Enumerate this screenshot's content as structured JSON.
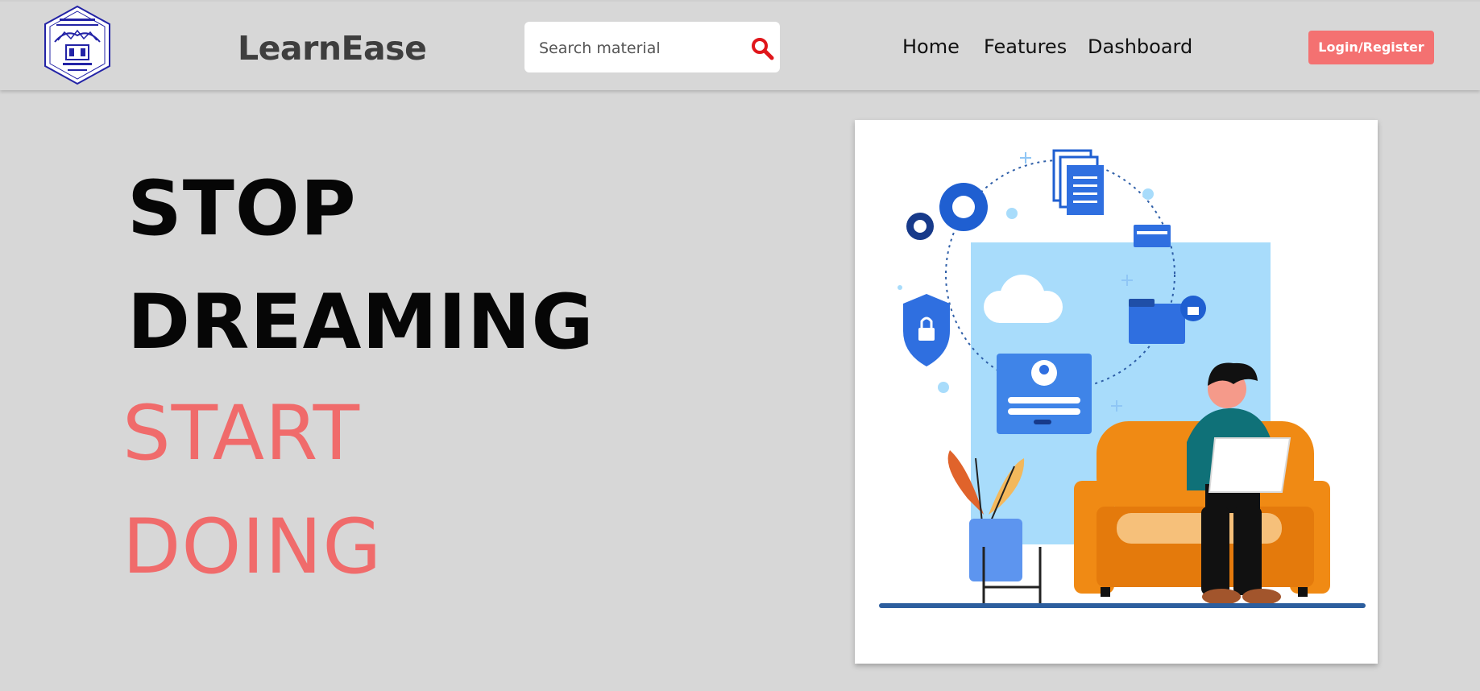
{
  "header": {
    "brand": "LearnEase",
    "search": {
      "placeholder": "Search material",
      "value": ""
    },
    "nav": [
      "Home",
      "Features",
      "Dashboard"
    ],
    "login_label": "Login/Register"
  },
  "hero": {
    "line1": "STOP",
    "line2": "DREAMING",
    "line3": "START",
    "line4": "DOING"
  },
  "colors": {
    "accent": "#f47171",
    "background": "#d7d7d7",
    "search_icon": "#e0161b"
  },
  "icons": [
    "college-logo-icon",
    "search-icon"
  ]
}
